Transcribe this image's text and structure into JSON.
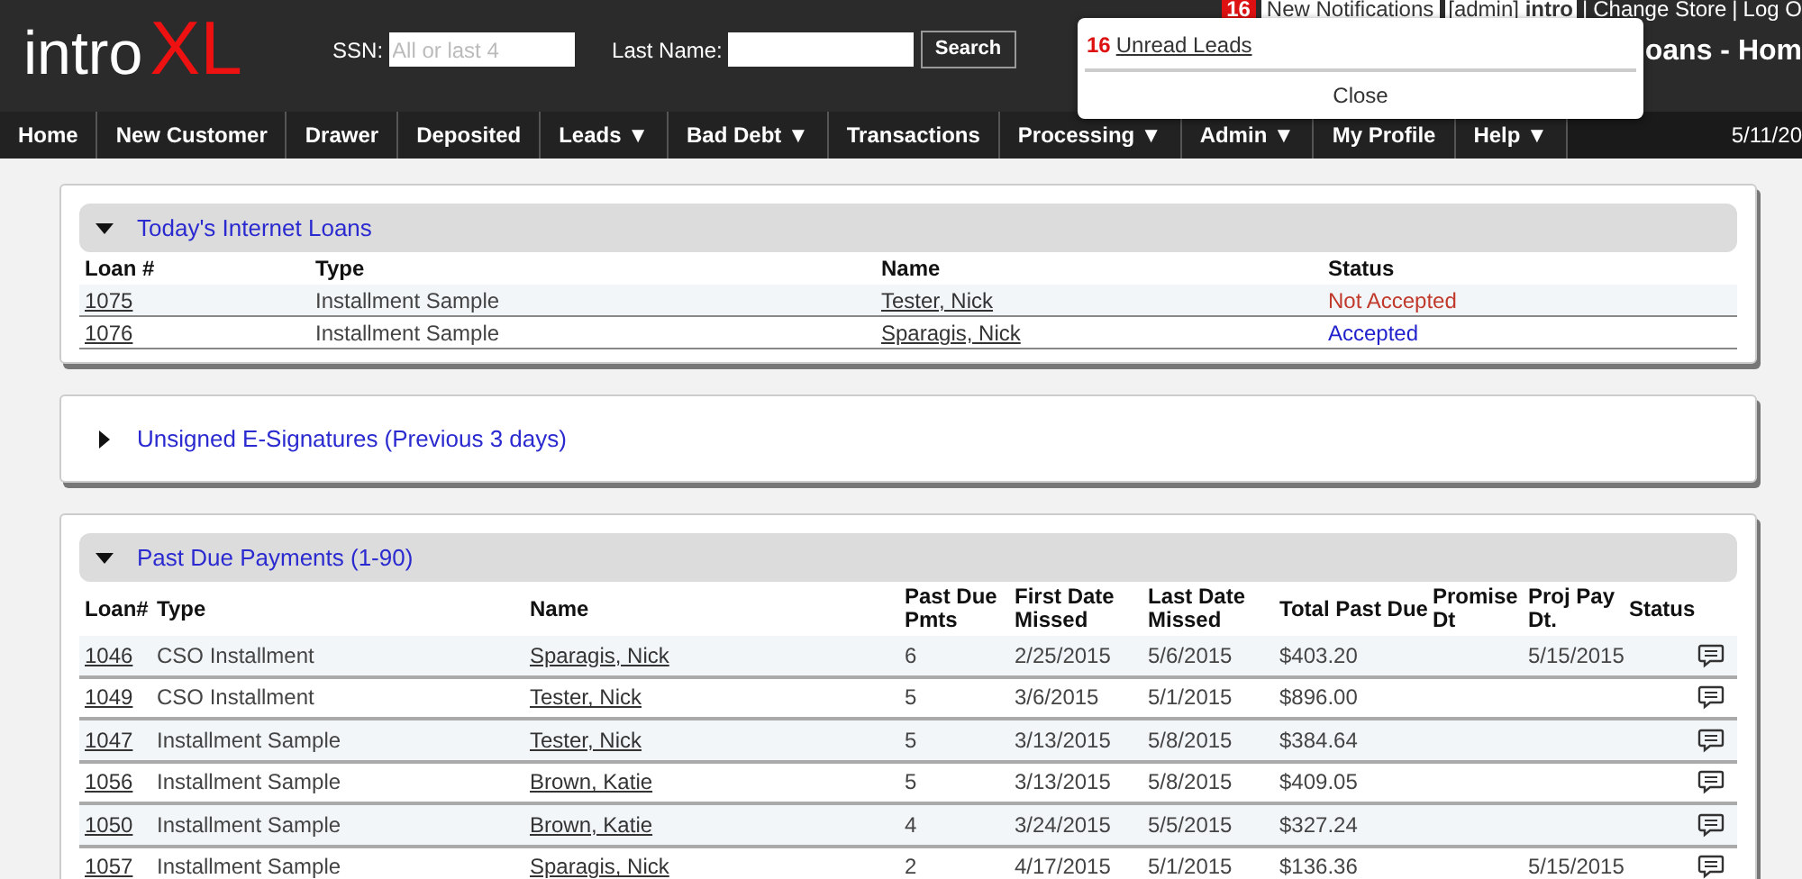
{
  "header": {
    "logo": {
      "part_1": "intro",
      "part_2": "XL"
    },
    "ssn_label": "SSN:",
    "ssn_placeholder": "All or last 4",
    "last_name_label": "Last Name:",
    "search_button": "Search",
    "notification_count": "16",
    "notifications_link": "New Notifications",
    "user": "[admin] **intro**",
    "separator_1": "|",
    "change_store": "Change Store",
    "separator_2": "|",
    "log_out": "Log O",
    "page_title": "oans - Hom"
  },
  "popup": {
    "count": "16",
    "link": "Unread Leads",
    "close": "Close"
  },
  "nav": {
    "items": [
      {
        "label": "Home"
      },
      {
        "label": "New Customer"
      },
      {
        "label": "Drawer"
      },
      {
        "label": "Deposited"
      },
      {
        "label": "Leads ▼"
      },
      {
        "label": "Bad Debt ▼"
      },
      {
        "label": "Transactions"
      },
      {
        "label": "Processing ▼"
      },
      {
        "label": "Admin ▼"
      },
      {
        "label": "My Profile"
      },
      {
        "label": "Help ▼"
      }
    ],
    "date": "5/11/20"
  },
  "internet_loans": {
    "title": "Today's Internet Loans",
    "expanded": true,
    "columns": [
      "Loan #",
      "Type",
      "Name",
      "Status"
    ],
    "rows": [
      {
        "loan": "1075",
        "type": "Installment Sample",
        "name": "Tester, Nick",
        "status": "Not Accepted",
        "color": "#c0392b"
      },
      {
        "loan": "1076",
        "type": "Installment Sample",
        "name": "Sparagis, Nick",
        "status": "Accepted",
        "color": "#2222cc"
      }
    ]
  },
  "unsigned": {
    "title": "Unsigned E-Signatures (Previous 3 days)",
    "expanded": false
  },
  "past_due": {
    "title": "Past Due Payments (1-90)",
    "expanded": true,
    "columns": [
      "Loan#",
      "Type",
      "Name",
      "Past Due Pmts",
      "First Date Missed",
      "Last Date Missed",
      "Total Past Due",
      "Promise Dt",
      "Proj Pay Dt.",
      "Status"
    ],
    "rows": [
      {
        "loan": "1046",
        "type": "CSO Installment",
        "name": "Sparagis, Nick",
        "pmts": "6",
        "first": "2/25/2015",
        "last": "5/6/2015",
        "total": "$403.20",
        "proj": "5/15/2015"
      },
      {
        "loan": "1049",
        "type": "CSO Installment",
        "name": "Tester, Nick",
        "pmts": "5",
        "first": "3/6/2015",
        "last": "5/1/2015",
        "total": "$896.00"
      },
      {
        "loan": "1047",
        "type": "Installment Sample",
        "name": "Tester, Nick",
        "pmts": "5",
        "first": "3/13/2015",
        "last": "5/8/2015",
        "total": "$384.64"
      },
      {
        "loan": "1056",
        "type": "Installment Sample",
        "name": "Brown, Katie",
        "pmts": "5",
        "first": "3/13/2015",
        "last": "5/8/2015",
        "total": "$409.05"
      },
      {
        "loan": "1050",
        "type": "Installment Sample",
        "name": "Brown, Katie",
        "pmts": "4",
        "first": "3/24/2015",
        "last": "5/5/2015",
        "total": "$327.24"
      },
      {
        "loan": "1057",
        "type": "Installment Sample",
        "name": "Sparagis, Nick",
        "pmts": "2",
        "first": "4/17/2015",
        "last": "5/1/2015",
        "total": "$136.36",
        "proj": "5/15/2015"
      }
    ]
  }
}
